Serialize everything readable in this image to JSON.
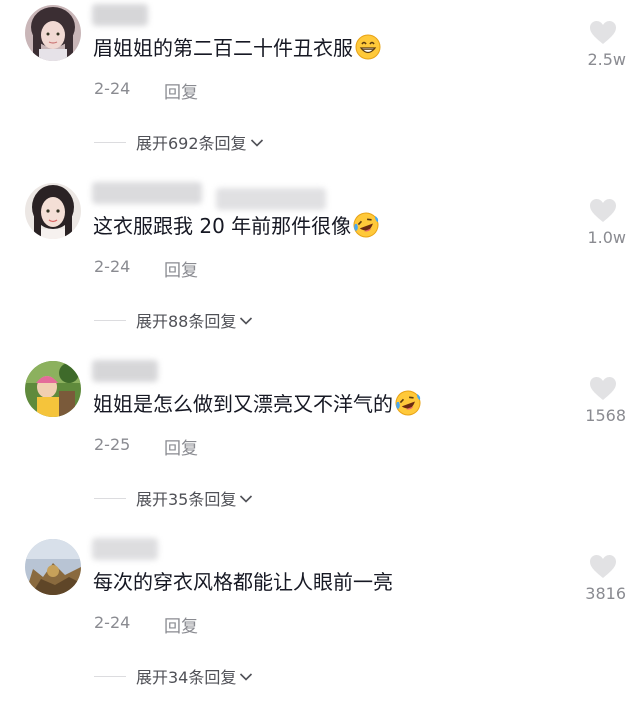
{
  "comments": [
    {
      "text": "眉姐姐的第二百二十件丑衣服",
      "emoji": "grinning-face-emoji",
      "date": "2-24",
      "reply": "回复",
      "likes": "2.5w",
      "expand": "展开692条回复"
    },
    {
      "text": "这衣服跟我 20 年前那件很像",
      "emoji": "laughing-tears-emoji",
      "date": "2-24",
      "reply": "回复",
      "likes": "1.0w",
      "expand": "展开88条回复"
    },
    {
      "text": "姐姐是怎么做到又漂亮又不洋气的",
      "emoji": "laughing-tears-emoji",
      "date": "2-25",
      "reply": "回复",
      "likes": "1568",
      "expand": "展开35条回复"
    },
    {
      "text": "每次的穿衣风格都能让人眼前一亮",
      "emoji": "",
      "date": "2-24",
      "reply": "回复",
      "likes": "3816",
      "expand": "展开34条回复"
    }
  ],
  "colors": {
    "text_primary": "#161823",
    "text_secondary": "#8a8b91",
    "expand_text": "#505157",
    "heart": "#e2e2e4",
    "username_blur": "#c9c9cc"
  }
}
